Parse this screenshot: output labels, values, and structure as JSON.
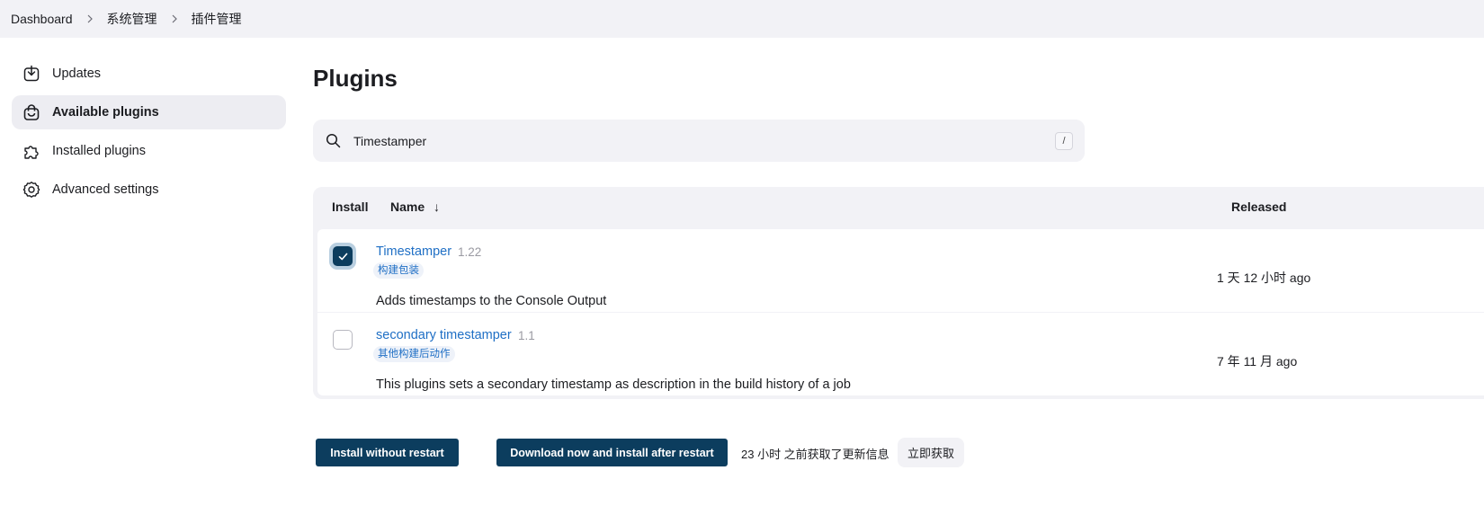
{
  "breadcrumb": {
    "items": [
      "Dashboard",
      "系统管理",
      "插件管理"
    ]
  },
  "sidebar": {
    "items": [
      {
        "label": "Updates",
        "icon": "download-icon"
      },
      {
        "label": "Available plugins",
        "icon": "shopping-bag-icon",
        "active": true
      },
      {
        "label": "Installed plugins",
        "icon": "puzzle-icon"
      },
      {
        "label": "Advanced settings",
        "icon": "gear-icon"
      }
    ]
  },
  "main": {
    "title": "Plugins",
    "search": {
      "value": "Timestamper",
      "shortcut": "/"
    },
    "table": {
      "headers": {
        "install": "Install",
        "name": "Name",
        "sort_indicator": "↓",
        "released": "Released"
      },
      "rows": [
        {
          "checked": true,
          "name": "Timestamper",
          "version": "1.22",
          "tag": "构建包装",
          "description": "Adds timestamps to the Console Output",
          "released": "1 天 12 小时 ago"
        },
        {
          "checked": false,
          "name": "secondary timestamper",
          "version": "1.1",
          "tag": "其他构建后动作",
          "description": "This plugins sets a secondary timestamp as description in the build history of a job",
          "released": "7 年 11 月 ago"
        }
      ]
    }
  },
  "footer": {
    "install_now_label": "Install without restart",
    "install_later_label": "Download now and install after restart",
    "update_status": "23 小时 之前获取了更新信息",
    "fetch_now_label": "立即获取"
  },
  "colors": {
    "accent": "#0c3d5e",
    "link": "#1f6fc5",
    "panel": "#f2f2f6"
  }
}
